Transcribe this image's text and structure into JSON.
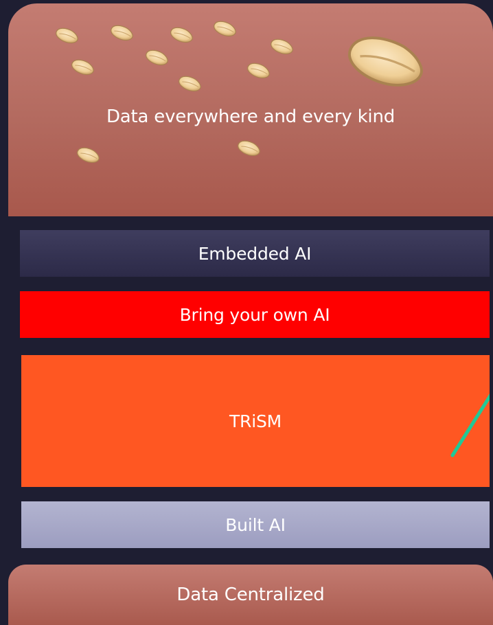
{
  "layers": {
    "data_everywhere": "Data everywhere and every kind",
    "embedded_ai": "Embedded AI",
    "bring_your_own_ai": "Bring your own AI",
    "trism": "TRiSM",
    "built_ai": "Built AI",
    "data_centralized": "Data Centralized"
  },
  "colors": {
    "background": "#1e1e32",
    "data_panel": "#b36a5f",
    "embedded_ai": "#34324f",
    "bring_your_own_ai": "#ff0000",
    "trism": "#ff5722",
    "built_ai": "#a8a9c8",
    "seed_fill": "#f2d4a0",
    "seed_stroke": "#b08a55",
    "trism_line": "#20c997"
  },
  "icons": {
    "seed": "seed-icon"
  }
}
